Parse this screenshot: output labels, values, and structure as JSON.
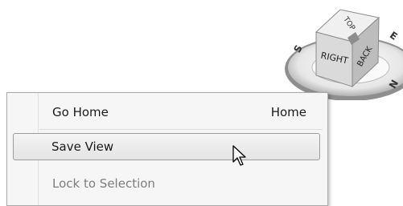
{
  "viewcube": {
    "faces": {
      "top": "TOP",
      "right": "RIGHT",
      "back": "BACK"
    },
    "compass": {
      "south": "S",
      "east": "E",
      "north": "N"
    }
  },
  "context_menu": {
    "items": [
      {
        "label": "Go Home",
        "shortcut": "Home",
        "state": "normal"
      },
      {
        "label": "Save View",
        "shortcut": "",
        "state": "highlighted"
      },
      {
        "label": "Lock to Selection",
        "shortcut": "",
        "state": "disabled"
      }
    ]
  }
}
